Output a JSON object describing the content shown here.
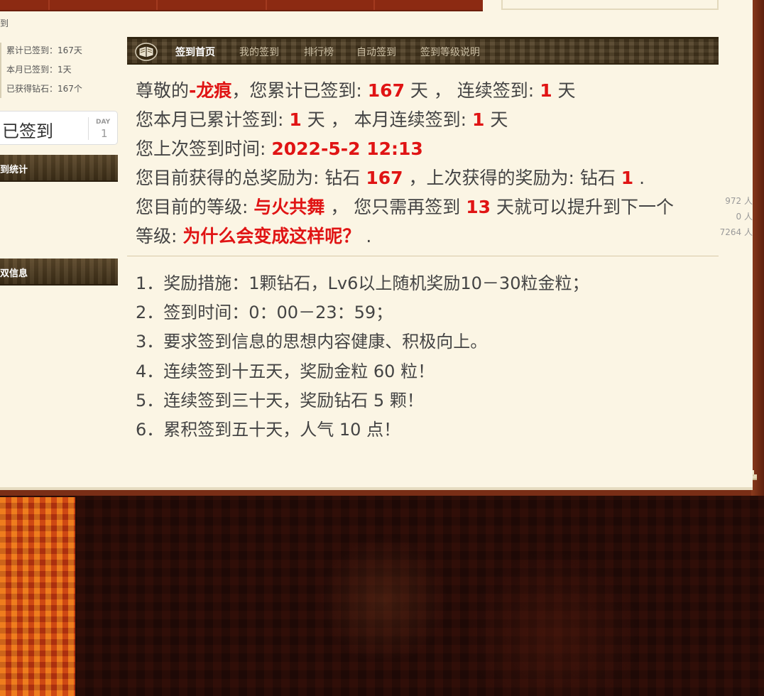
{
  "breadcrumb_fragment": "到",
  "sidebar": {
    "stats": [
      {
        "label": "累计已签到：",
        "value": "167天"
      },
      {
        "label": "本月已签到：",
        "value": "1天"
      },
      {
        "label": "已获得钻石：",
        "value": "167个"
      }
    ],
    "signed_button": {
      "label": "已签到",
      "day_label": "DAY",
      "day_value": "1"
    },
    "stats_heading": "到统计",
    "stats_numbers": [
      "972 人",
      "0 人",
      "7264 人"
    ],
    "info_heading": "双信息"
  },
  "nav": {
    "items": [
      "签到首页",
      "我的签到",
      "排行榜",
      "自动签到",
      "签到等级说明"
    ],
    "active_index": 0
  },
  "summary": {
    "line1": {
      "prefix": "尊敬的",
      "username": "-龙痕",
      "mid1": "，您累计已签到: ",
      "total_days": "167",
      "mid2": " 天 ， 连续签到: ",
      "streak": "1",
      "suffix": " 天"
    },
    "line2": {
      "prefix": "您本月已累计签到: ",
      "month_days": "1",
      "mid": " 天 ， 本月连续签到: ",
      "month_streak": "1",
      "suffix": " 天"
    },
    "line3": {
      "prefix": "您上次签到时间: ",
      "last_time": "2022-5-2 12:13"
    },
    "line4": {
      "prefix": "您目前获得的总奖励为: 钻石 ",
      "total_reward": "167",
      "mid": " ，上次获得的奖励为: 钻石 ",
      "last_reward": "1",
      "suffix": " ."
    },
    "line5": {
      "prefix": "您目前的等级: ",
      "level": "与火共舞",
      "mid": " ， 您只需再签到 ",
      "days_needed": "13",
      "suffix": " 天就可以提升到下一个"
    },
    "line6": {
      "prefix": "等级: ",
      "next_level": "为什么会变成这样呢？",
      "suffix": " ."
    }
  },
  "rules": [
    "1．奖励措施：1颗钻石，Lv6以上随机奖励10－30粒金粒；",
    "2．签到时间：0：00－23：59；",
    "3．要求签到信息的思想内容健康、积极向上。",
    "4．连续签到十五天，奖励金粒 60 粒！",
    "5．连续签到三十天，奖励钻石 5 颗！",
    "6．累积签到五十天，人气 10 点！"
  ],
  "colors": {
    "accent_red": "#e01414",
    "nav_bg": "#4e3d22",
    "paper": "#fbf5e4",
    "book_edge": "#7a2e16"
  },
  "icons": {
    "nav_logo": "book-logo-icon"
  }
}
